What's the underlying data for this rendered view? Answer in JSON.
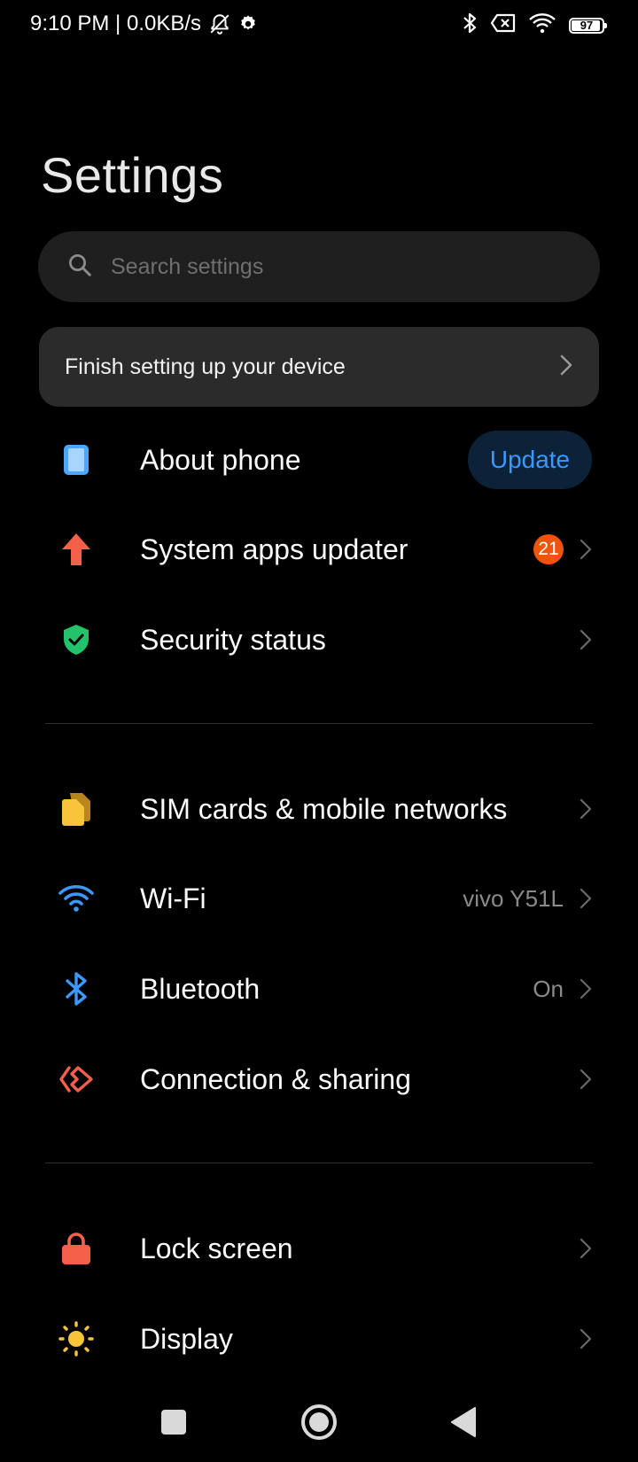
{
  "status_bar": {
    "time_speed": "9:10 PM | 0.0KB/s",
    "battery": "97",
    "icons": [
      "bell-off-icon",
      "gear-icon",
      "bluetooth-icon",
      "no-sim-icon",
      "wifi-icon",
      "battery-icon"
    ]
  },
  "page": {
    "title": "Settings"
  },
  "search": {
    "placeholder": "Search settings"
  },
  "setup_card": {
    "label": "Finish setting up your device"
  },
  "items": {
    "about": {
      "label": "About phone",
      "action": "Update",
      "icon": "phone-icon",
      "color": "#4aa6ff"
    },
    "updater": {
      "label": "System apps updater",
      "badge": "21",
      "icon": "arrow-up-icon",
      "color": "#f5604a"
    },
    "security": {
      "label": "Security status",
      "icon": "shield-check-icon",
      "color": "#22c36b"
    },
    "sim": {
      "label": "SIM cards & mobile networks",
      "icon": "sim-icon",
      "color": "#f8c53a"
    },
    "wifi": {
      "label": "Wi-Fi",
      "value": "vivo Y51L",
      "icon": "wifi-icon",
      "color": "#3b98ff"
    },
    "bluetooth": {
      "label": "Bluetooth",
      "value": "On",
      "icon": "bluetooth-icon",
      "color": "#3b98ff"
    },
    "connection": {
      "label": "Connection & sharing",
      "icon": "connection-icon",
      "color": "#f5604a"
    },
    "lock": {
      "label": "Lock screen",
      "icon": "lock-icon",
      "color": "#f5604a"
    },
    "display": {
      "label": "Display",
      "icon": "sun-icon",
      "color": "#f8c53a"
    }
  },
  "nav_bar": {
    "buttons": [
      "recents-button",
      "home-button",
      "back-button"
    ]
  },
  "colors": {
    "background": "#000000",
    "accent": "#3b98ff",
    "badge": "#f0540c"
  }
}
